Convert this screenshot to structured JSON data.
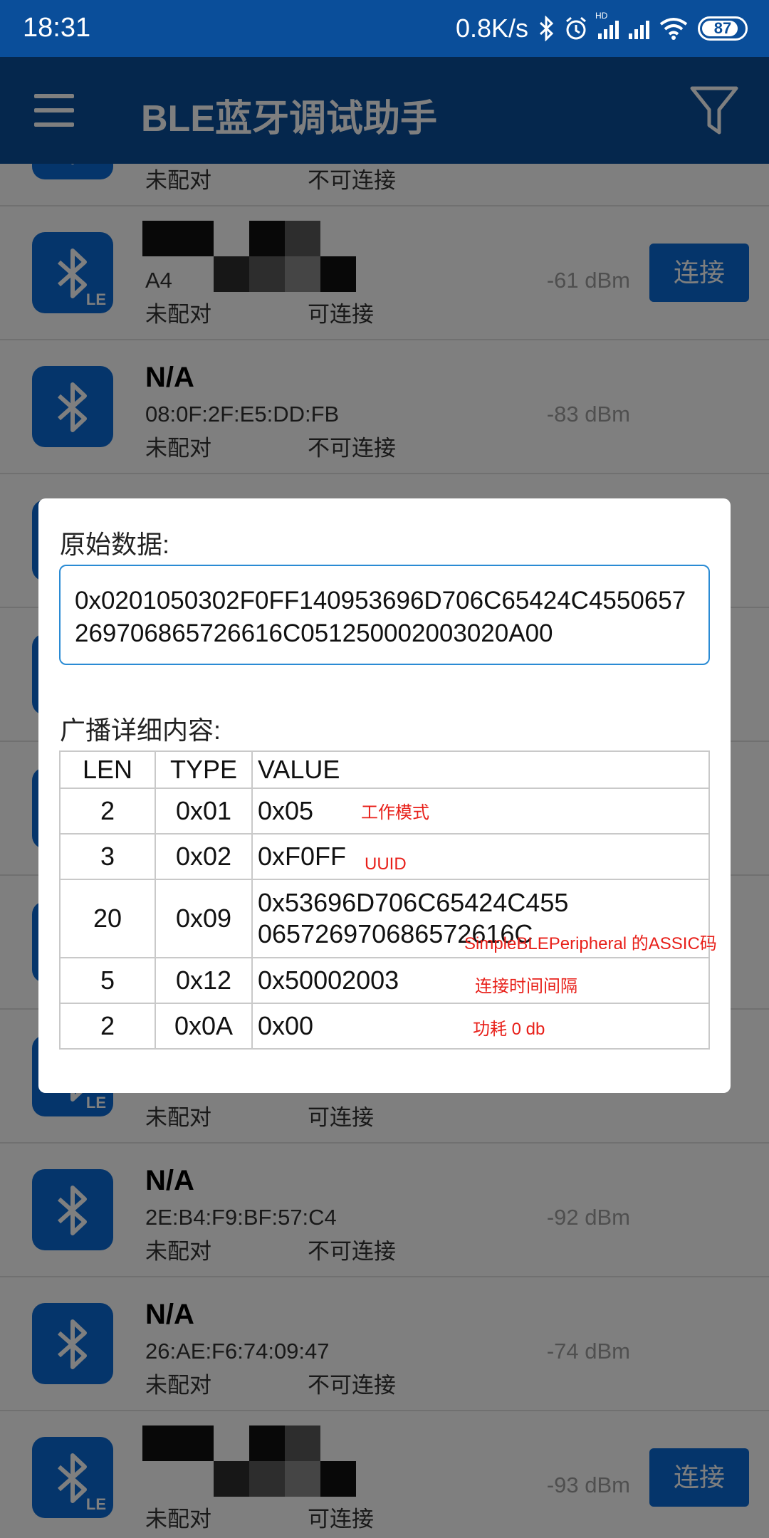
{
  "status_bar": {
    "time": "18:31",
    "net_speed": "0.8K/s",
    "battery": "87",
    "battery_level": 0.87,
    "hd_label": "HD"
  },
  "app_bar": {
    "title": "BLE蓝牙调试助手"
  },
  "devices": [
    {
      "name": "",
      "mac": "",
      "bond": "未配对",
      "conn": "不可连接",
      "rssi": "",
      "le": false,
      "button": ""
    },
    {
      "name": "",
      "mac": "A4",
      "bond": "未配对",
      "conn": "可连接",
      "rssi": "-61 dBm",
      "le": true,
      "button": "连接"
    },
    {
      "name": "N/A",
      "mac": "08:0F:2F:E5:DD:FB",
      "bond": "未配对",
      "conn": "不可连接",
      "rssi": "-83 dBm",
      "le": false,
      "button": ""
    },
    {
      "name": "",
      "mac": "",
      "bond": "",
      "conn": "",
      "rssi": "",
      "le": false,
      "button": ""
    },
    {
      "name": "",
      "mac": "",
      "bond": "",
      "conn": "",
      "rssi": "",
      "le": false,
      "button": ""
    },
    {
      "name": "",
      "mac": "",
      "bond": "",
      "conn": "",
      "rssi": "",
      "le": false,
      "button": ""
    },
    {
      "name": "",
      "mac": "",
      "bond": "",
      "conn": "",
      "rssi": "",
      "le": false,
      "button": ""
    },
    {
      "name": "",
      "mac": "",
      "bond": "未配对",
      "conn": "可连接",
      "rssi": "",
      "le": true,
      "button": ""
    },
    {
      "name": "N/A",
      "mac": "2E:B4:F9:BF:57:C4",
      "bond": "未配对",
      "conn": "不可连接",
      "rssi": "-92 dBm",
      "le": false,
      "button": ""
    },
    {
      "name": "N/A",
      "mac": "26:AE:F6:74:09:47",
      "bond": "未配对",
      "conn": "不可连接",
      "rssi": "-74 dBm",
      "le": false,
      "button": ""
    },
    {
      "name": "",
      "mac": "",
      "bond": "未配对",
      "conn": "可连接",
      "rssi": "-93 dBm",
      "le": true,
      "button": "连接"
    }
  ],
  "dialog": {
    "raw_label": "原始数据:",
    "raw_value": "0x0201050302F0FF140953696D706C65424C4550657269706865726616C051250002003020A00",
    "detail_label": "广播详细内容:",
    "table": {
      "headers": [
        "LEN",
        "TYPE",
        "VALUE"
      ],
      "rows": [
        {
          "len": "2",
          "type": "0x01",
          "value": "0x05",
          "note": "工作模式"
        },
        {
          "len": "3",
          "type": "0x02",
          "value": "0xF0FF",
          "note": "UUID"
        },
        {
          "len": "20",
          "type": "0x09",
          "value": "0x53696D706C65424C455065726970686572616C",
          "note": "SimpleBLEPeripheral 的ASSIC码"
        },
        {
          "len": "5",
          "type": "0x12",
          "value": "0x50002003",
          "note": "连接时间间隔"
        },
        {
          "len": "2",
          "type": "0x0A",
          "value": "0x00",
          "note": "功耗 0 db"
        }
      ]
    }
  },
  "colors": {
    "primary": "#0a4e9a",
    "icon_blue": "#0a6bd6",
    "annotation_red": "#e8201a"
  }
}
